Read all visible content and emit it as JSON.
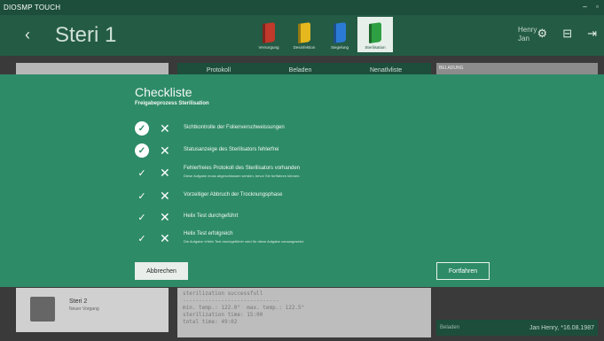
{
  "window": {
    "title": "DIOSMP TOUCH",
    "minimize": "–",
    "maximize": "▫"
  },
  "header": {
    "back": "‹",
    "title": "Steri 1",
    "nav": [
      {
        "label": "Versorgung",
        "color": "#c0392b"
      },
      {
        "label": "Desinfektion",
        "color": "#e5b81e"
      },
      {
        "label": "Siegelung",
        "color": "#2b7bd6"
      },
      {
        "label": "Sterilisation",
        "color": "#2ea043",
        "active": true
      }
    ],
    "user": {
      "first": "Henry",
      "last": "Jan"
    },
    "icons": [
      "gear-icon",
      "minus-square-icon",
      "logout-icon"
    ]
  },
  "background": {
    "tabs": [
      "Protokoll",
      "Beladen",
      "Nenatlvliste"
    ],
    "right_panel_label": "BELADUNG",
    "list_item": {
      "name": "Steri 2",
      "sub": "Neuer Vorgang"
    },
    "console": "sterilization successfull\n------------------------------\nmin. temp.: 122.0°  max. temp.: 122.5°\nsterilization time: 15:00\ntotal time: 49:02",
    "status": {
      "left": "Beladen",
      "right": "Jan Henry, *16.08.1987"
    }
  },
  "dialog": {
    "title": "Checkliste",
    "subtitle": "Freigabeprozess Sterilisation",
    "items": [
      {
        "label": "Sichtkontrolle der Folienverschweissungen",
        "note": "",
        "checked": true
      },
      {
        "label": "Statusanzeige des Sterilisators fehlerfrei",
        "note": "",
        "checked": true
      },
      {
        "label": "Fehlerfreies Protokoll des Sterilisators vorhanden",
        "note": "Diese Aufgabe muss abgeschlossen werden, bevor Sie fortfahren können.",
        "checked": false
      },
      {
        "label": "Vorzeitiger Abbruch der Trocknungsphase",
        "note": "",
        "checked": false
      },
      {
        "label": "Helix Test durchgeführt",
        "note": "",
        "checked": false
      },
      {
        "label": "Helix Test erfolgreich",
        "note": "Die Aufgabe »Helix Test durchgeführt« wird für diese Aufgabe vorausgesetzt.",
        "checked": false
      }
    ],
    "cancel": "Abbrechen",
    "continue": "Fortfahren",
    "check_glyph": "✓",
    "cross_glyph": "✕"
  }
}
